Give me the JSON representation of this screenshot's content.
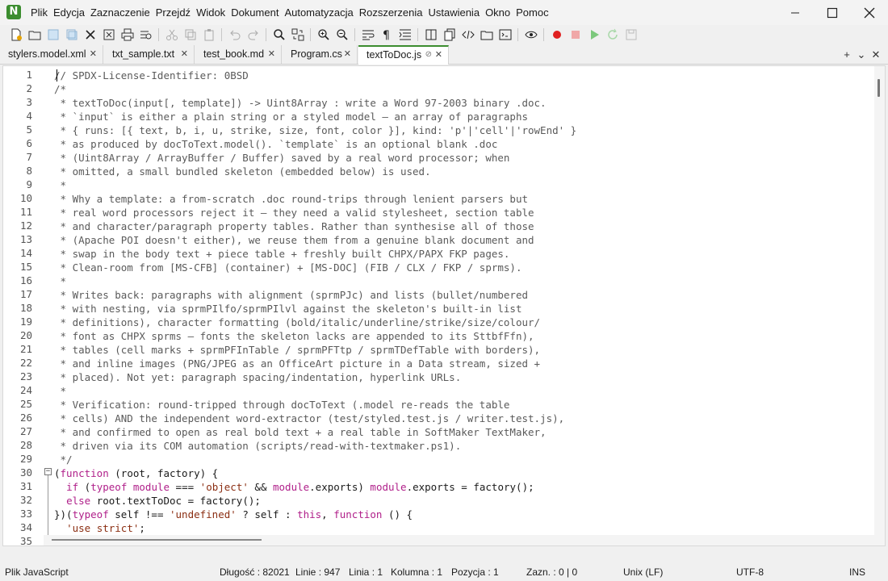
{
  "app": {
    "logo_letter": "N"
  },
  "menu": [
    "Plik",
    "Edycja",
    "Zaznaczenie",
    "Przejdź",
    "Widok",
    "Dokument",
    "Automatyzacja",
    "Rozszerzenia",
    "Ustawienia",
    "Okno",
    "Pomoc"
  ],
  "tabs": [
    {
      "label": "stylers.model.xml",
      "close": "✕"
    },
    {
      "label": "txt_sample.txt",
      "close": "✕"
    },
    {
      "label": "test_book.md",
      "close": "✕"
    },
    {
      "label": "Program.cs",
      "close": "✕"
    },
    {
      "label": "textToDoc.js",
      "close": "✕",
      "pin": "⊘"
    }
  ],
  "tab_controls": {
    "add": "+",
    "list": "⌄",
    "close": "✕"
  },
  "editor": {
    "line_numbers": [
      "1",
      "2",
      "3",
      "4",
      "5",
      "6",
      "7",
      "8",
      "9",
      "10",
      "11",
      "12",
      "13",
      "14",
      "15",
      "16",
      "17",
      "18",
      "19",
      "20",
      "21",
      "22",
      "23",
      "24",
      "25",
      "26",
      "27",
      "28",
      "29",
      "30",
      "31",
      "32",
      "33",
      "34",
      "35"
    ],
    "lines": [
      "// SPDX-License-Identifier: 0BSD",
      "/*",
      " * textToDoc(input[, template]) -> Uint8Array : write a Word 97-2003 binary .doc.",
      " * `input` is either a plain string or a styled model — an array of paragraphs",
      " * { runs: [{ text, b, i, u, strike, size, font, color }], kind: 'p'|'cell'|'rowEnd' }",
      " * as produced by docToText.model(). `template` is an optional blank .doc",
      " * (Uint8Array / ArrayBuffer / Buffer) saved by a real word processor; when",
      " * omitted, a small bundled skeleton (embedded below) is used.",
      " *",
      " * Why a template: a from-scratch .doc round-trips through lenient parsers but",
      " * real word processors reject it — they need a valid stylesheet, section table",
      " * and character/paragraph property tables. Rather than synthesise all of those",
      " * (Apache POI doesn't either), we reuse them from a genuine blank document and",
      " * swap in the body text + piece table + freshly built CHPX/PAPX FKP pages.",
      " * Clean-room from [MS-CFB] (container) + [MS-DOC] (FIB / CLX / FKP / sprms).",
      " *",
      " * Writes back: paragraphs with alignment (sprmPJc) and lists (bullet/numbered",
      " * with nesting, via sprmPIlfo/sprmPIlvl against the skeleton's built-in list",
      " * definitions), character formatting (bold/italic/underline/strike/size/colour/",
      " * font as CHPX sprms — fonts the skeleton lacks are appended to its SttbfFfn),",
      " * tables (cell marks + sprmPFInTable / sprmPFTtp / sprmTDefTable with borders),",
      " * and inline images (PNG/JPEG as an OfficeArt picture in a Data stream, sized +",
      " * placed). Not yet: paragraph spacing/indentation, hyperlink URLs.",
      " *",
      " * Verification: round-tripped through docToText (.model re-reads the table",
      " * cells) AND the independent word-extractor (test/styled.test.js / writer.test.js),",
      " * and confirmed to open as real bold text + a real table in SoftMaker TextMaker,",
      " * driven via its COM automation (scripts/read-with-textmaker.ps1).",
      " */",
      "",
      "",
      "",
      "",
      "",
      ""
    ],
    "code_tokens": {
      "l30": [
        "(",
        "function",
        " (root, factory) {"
      ],
      "l31": [
        "  ",
        "if",
        " (",
        "typeof",
        " ",
        "module",
        " === ",
        "'object'",
        " && ",
        "module",
        ".exports) ",
        "module",
        ".exports = factory();"
      ],
      "l32": [
        "  ",
        "else",
        " root.textToDoc = factory();"
      ],
      "l33": [
        "})(",
        "typeof",
        " self !== ",
        "'undefined'",
        " ? self : ",
        "this",
        ", ",
        "function",
        " () {"
      ],
      "l34": [
        "  ",
        "'use strict'",
        ";"
      ]
    }
  },
  "status": {
    "language": "Plik JavaScript",
    "length": "Długość : 82021",
    "lines": "Linie : 947",
    "line": "Linia : 1",
    "column": "Kolumna : 1",
    "position": "Pozycja : 1",
    "selection": "Zazn. : 0 | 0",
    "eol": "Unix (LF)",
    "encoding": "UTF-8",
    "mode": "INS"
  },
  "colors": {
    "accent": "#3c8d2f",
    "keyword": "#b0208a",
    "string": "#8b2e12",
    "comment": "#5a5a5a",
    "record": "#e02020",
    "play": "#7cc87c"
  }
}
